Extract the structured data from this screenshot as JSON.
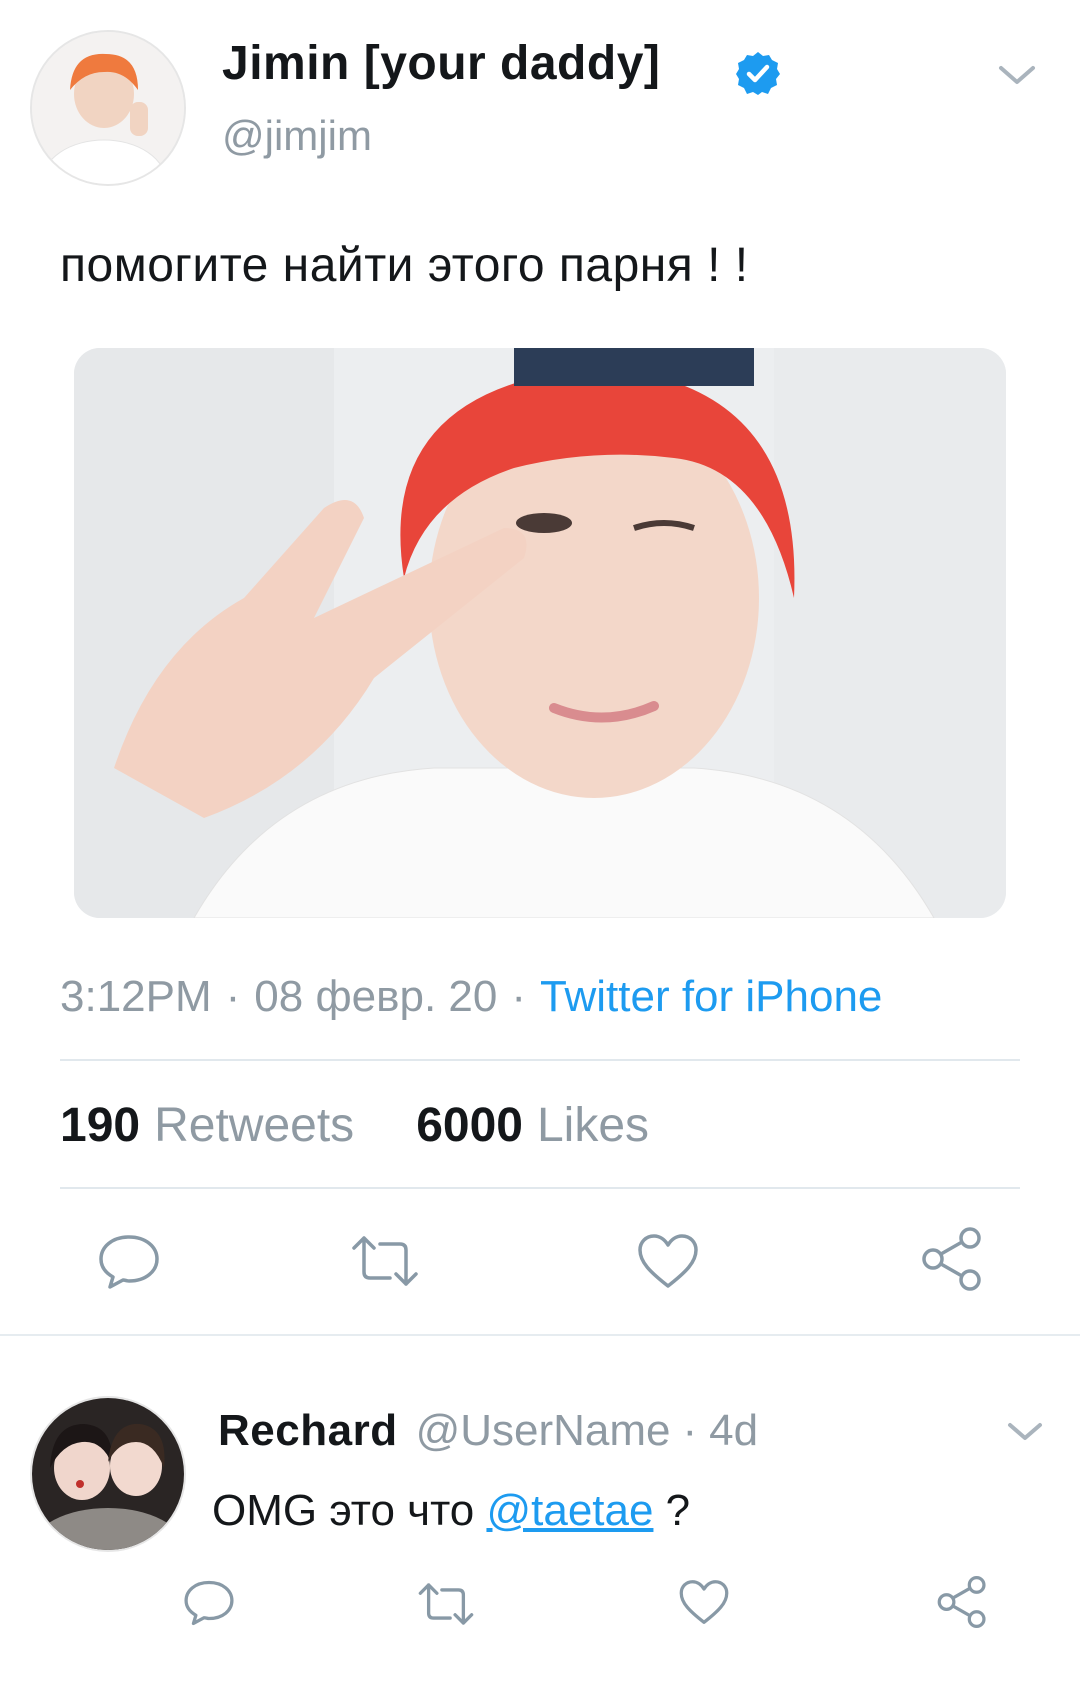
{
  "tweet": {
    "author": {
      "name": "Jimin [your daddy]",
      "handle": "@jimjim",
      "verified": true,
      "avatar": "avatar-photo-icon"
    },
    "text": "помогите найти этого парня ! !",
    "media": "photo-icon",
    "meta": {
      "time": "3:12PM",
      "date": "08 февр. 20",
      "separator": "·",
      "source": "Twitter for iPhone"
    },
    "stats": {
      "retweets_count": "190",
      "retweets_label": "Retweets",
      "likes_count": "6000",
      "likes_label": "Likes"
    },
    "actions": [
      "reply-icon",
      "retweet-icon",
      "like-icon",
      "share-icon"
    ]
  },
  "reply": {
    "name": "Rechard",
    "handle": "@UserName",
    "separator": "·",
    "time": "4d",
    "text_before": "OMG это что ",
    "mention": "@taetae",
    "text_after": " ?",
    "actions": [
      "reply-icon",
      "retweet-icon",
      "like-icon",
      "share-icon"
    ]
  },
  "colors": {
    "accent": "#1d9bf0",
    "verified": "#1d9bf0",
    "secondary_text": "#8f9aa3",
    "icon": "#8899a6",
    "divider": "#e1e8ed"
  }
}
